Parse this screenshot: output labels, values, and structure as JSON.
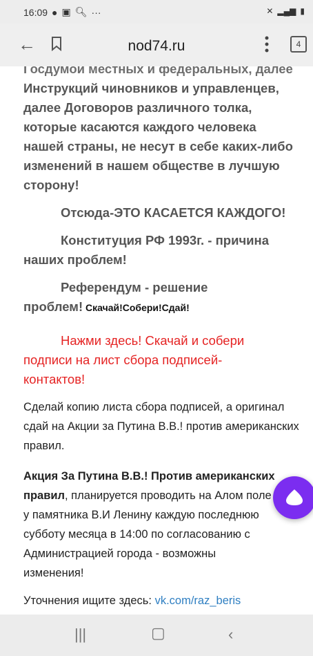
{
  "status_bar": {
    "time": "16:09",
    "extra": "···"
  },
  "browser": {
    "url": "nod74.ru",
    "tab_count": "4"
  },
  "article": {
    "partial_line": "Госдумой местных и федеральных, далее",
    "para1": "Инструкций чиновников и управленцев, далее Договоров различного толка, которые касаются каждого человека нашей страны, не несут в себе каких-либо изменений в нашем обществе в лучшую сторону!",
    "para2": "Отсюда-ЭТО КАСАЕТСЯ КАЖДОГО!",
    "para3_line1": "Конституция РФ 1993г. - причина",
    "para3_line2": "наших проблем!",
    "para4_line1": "Референдум - решение",
    "para4_line2": "проблем!",
    "para4_tail": " Скачай!Собери!Сдай!",
    "red_line1": "Нажми здесь! Скачай и собери",
    "red_line2": "подписи на  лист сбора подписей-",
    "red_line3": "контактов!",
    "copy_para": "Сделай копию листа сбора подписей, а оригинал сдай на Акции за Путина В.В.! против американских правил.",
    "action_bold1": "Акция За Путина В.В.! Против американских",
    "action_bold2": "правил",
    "action_rest": ", планируется проводить на Алом поле у памятника В.И Ленину каждую последнюю субботу месяца в 14:00 по согласованию с Администрацией города - возможны изменения!",
    "clarify_label": "Уточнения ищите здесь: ",
    "clarify_link": "vk.com/raz_beris"
  },
  "colors": {
    "accent_red": "#e52323",
    "link_blue": "#2f7fc2",
    "assistant_purple": "#7b2df0"
  }
}
